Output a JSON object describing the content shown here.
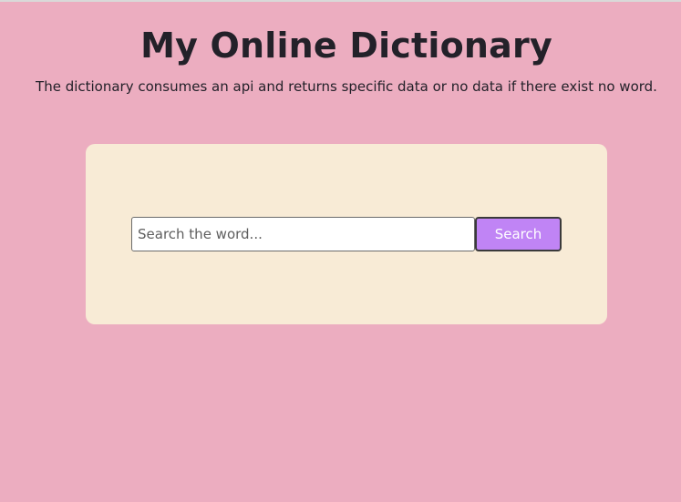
{
  "header": {
    "title": "My Online Dictionary",
    "subtitle": "The dictionary consumes an api and returns specific data or no data if there exist no word."
  },
  "search": {
    "placeholder": "Search the word...",
    "value": "",
    "button_label": "Search"
  },
  "colors": {
    "page_background": "#ecadc0",
    "card_background": "#f8ebd6",
    "button_background": "#c084f5",
    "text": "#232129"
  }
}
